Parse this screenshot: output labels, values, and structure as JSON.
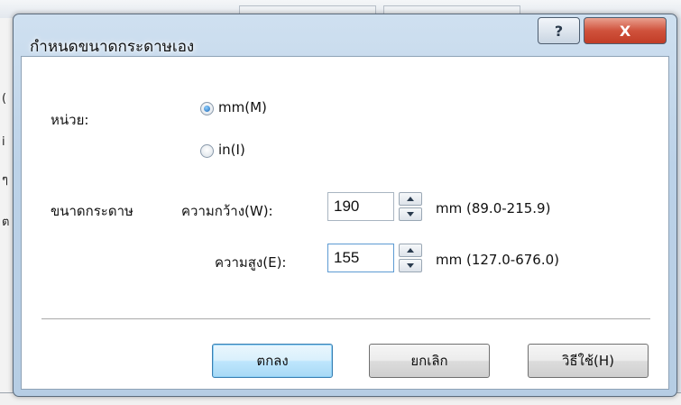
{
  "dialog": {
    "title": "กำหนดขนาดกระดาษเอง",
    "help_glyph": "?",
    "close_glyph": "X"
  },
  "unit": {
    "label": "หน่วย:",
    "options": [
      {
        "label": "mm(M)",
        "selected": true
      },
      {
        "label": "in(I)",
        "selected": false
      }
    ]
  },
  "paper_size": {
    "label": "ขนาดกระดาษ",
    "width": {
      "label": "ความกว้าง(W):",
      "value": "190",
      "range": "mm (89.0-215.9)"
    },
    "height": {
      "label": "ความสูง(E):",
      "value": "155",
      "range": "mm (127.0-676.0)"
    }
  },
  "buttons": {
    "ok": "ตกลง",
    "cancel": "ยกเลิก",
    "help": "วิธีใช้(H)"
  },
  "colors": {
    "accent": "#3c7fb1",
    "close": "#c23d27",
    "frame": "#bcd2e8"
  }
}
